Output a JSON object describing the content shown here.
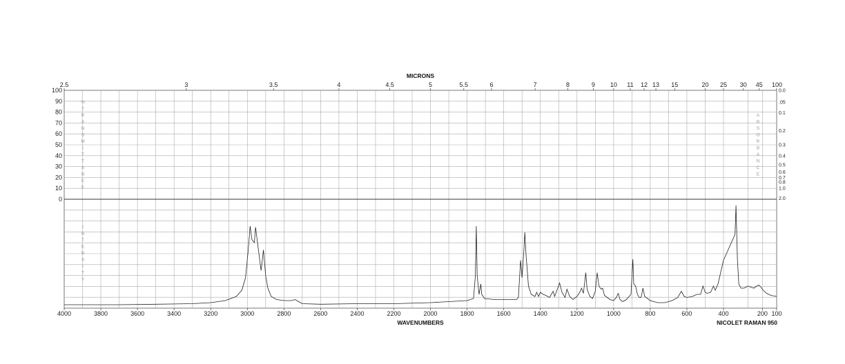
{
  "chart_data": {
    "type": "line",
    "top_axis_title": "MICRONS",
    "micron_ticks": [
      "2.5",
      "3",
      "3.5",
      "4",
      "4.5",
      "5",
      "5.5",
      "6",
      "7",
      "8",
      "9",
      "10",
      "11",
      "12",
      "13",
      "15",
      "20",
      "25",
      "30",
      "45",
      "100"
    ],
    "transmittance_ticks": [
      "100",
      "90",
      "80",
      "70",
      "60",
      "50",
      "40",
      "30",
      "20",
      "10",
      "0"
    ],
    "transmittance_label": "%TRANSMITTANCE",
    "absorbance_ticks": [
      "0.0",
      ".05",
      "0.1",
      "0.2",
      "0.3",
      "0.4",
      "0.5",
      "0.6",
      "0.7",
      "0.8",
      "1.0",
      "2.0"
    ],
    "absorbance_label": "ABSORBANCE",
    "intensity_label": "INTENSITY",
    "x_axis_title": "WAVENUMBERS",
    "x_ticks": [
      "4000",
      "3800",
      "3600",
      "3400",
      "3200",
      "3000",
      "2800",
      "2600",
      "2400",
      "2200",
      "2000",
      "1800",
      "1600",
      "1400",
      "1200",
      "1000",
      "800",
      "600",
      "400",
      "200",
      "100"
    ],
    "instrument": "NICOLET RAMAN 950",
    "xlim": [
      4000,
      100
    ],
    "intensity_range": [
      0,
      100
    ],
    "series": [
      {
        "points": [
          [
            4000,
            2
          ],
          [
            3700,
            2
          ],
          [
            3500,
            2.5
          ],
          [
            3300,
            3
          ],
          [
            3200,
            4
          ],
          [
            3120,
            6
          ],
          [
            3060,
            10
          ],
          [
            3030,
            16
          ],
          [
            3010,
            28
          ],
          [
            2995,
            55
          ],
          [
            2985,
            78
          ],
          [
            2975,
            65
          ],
          [
            2962,
            62
          ],
          [
            2955,
            77
          ],
          [
            2943,
            60
          ],
          [
            2925,
            35
          ],
          [
            2912,
            55
          ],
          [
            2900,
            30
          ],
          [
            2888,
            18
          ],
          [
            2870,
            10
          ],
          [
            2840,
            7
          ],
          [
            2800,
            6
          ],
          [
            2760,
            6
          ],
          [
            2740,
            7
          ],
          [
            2720,
            5
          ],
          [
            2700,
            3
          ],
          [
            2600,
            2.5
          ],
          [
            2400,
            3
          ],
          [
            2200,
            3
          ],
          [
            2000,
            4
          ],
          [
            1900,
            5
          ],
          [
            1800,
            6
          ],
          [
            1765,
            8
          ],
          [
            1755,
            30
          ],
          [
            1750,
            78
          ],
          [
            1745,
            30
          ],
          [
            1735,
            12
          ],
          [
            1725,
            22
          ],
          [
            1720,
            12
          ],
          [
            1705,
            8
          ],
          [
            1650,
            7
          ],
          [
            1600,
            7
          ],
          [
            1530,
            7
          ],
          [
            1520,
            9
          ],
          [
            1508,
            45
          ],
          [
            1500,
            28
          ],
          [
            1490,
            55
          ],
          [
            1485,
            72
          ],
          [
            1478,
            50
          ],
          [
            1465,
            20
          ],
          [
            1450,
            12
          ],
          [
            1430,
            10
          ],
          [
            1420,
            14
          ],
          [
            1410,
            10
          ],
          [
            1400,
            14
          ],
          [
            1385,
            12
          ],
          [
            1370,
            11
          ],
          [
            1350,
            9
          ],
          [
            1330,
            15
          ],
          [
            1322,
            10
          ],
          [
            1305,
            18
          ],
          [
            1295,
            23
          ],
          [
            1282,
            14
          ],
          [
            1265,
            9
          ],
          [
            1255,
            17
          ],
          [
            1240,
            10
          ],
          [
            1222,
            7
          ],
          [
            1200,
            10
          ],
          [
            1185,
            14
          ],
          [
            1175,
            18
          ],
          [
            1165,
            13
          ],
          [
            1152,
            33
          ],
          [
            1145,
            17
          ],
          [
            1130,
            10
          ],
          [
            1115,
            8
          ],
          [
            1100,
            15
          ],
          [
            1090,
            33
          ],
          [
            1080,
            20
          ],
          [
            1068,
            17
          ],
          [
            1060,
            18
          ],
          [
            1050,
            11
          ],
          [
            1020,
            7
          ],
          [
            1000,
            6
          ],
          [
            985,
            9
          ],
          [
            975,
            13
          ],
          [
            965,
            7
          ],
          [
            950,
            5
          ],
          [
            930,
            7
          ],
          [
            905,
            12
          ],
          [
            895,
            46
          ],
          [
            890,
            22
          ],
          [
            880,
            20
          ],
          [
            870,
            12
          ],
          [
            860,
            9
          ],
          [
            850,
            9
          ],
          [
            840,
            18
          ],
          [
            830,
            10
          ],
          [
            800,
            6
          ],
          [
            760,
            4
          ],
          [
            720,
            4
          ],
          [
            700,
            5
          ],
          [
            680,
            6
          ],
          [
            650,
            9
          ],
          [
            630,
            15
          ],
          [
            615,
            10
          ],
          [
            600,
            9
          ],
          [
            570,
            10
          ],
          [
            545,
            12
          ],
          [
            525,
            12
          ],
          [
            512,
            20
          ],
          [
            500,
            14
          ],
          [
            490,
            13
          ],
          [
            470,
            14
          ],
          [
            455,
            20
          ],
          [
            445,
            16
          ],
          [
            430,
            22
          ],
          [
            400,
            45
          ],
          [
            392,
            70
          ],
          [
            385,
            98
          ],
          [
            375,
            45
          ],
          [
            365,
            22
          ],
          [
            350,
            18
          ],
          [
            330,
            18
          ],
          [
            300,
            20
          ],
          [
            280,
            19
          ],
          [
            260,
            18
          ],
          [
            240,
            20
          ],
          [
            225,
            21
          ],
          [
            210,
            19
          ],
          [
            195,
            16
          ],
          [
            170,
            13
          ],
          [
            140,
            11
          ],
          [
            100,
            10
          ]
        ]
      }
    ]
  }
}
